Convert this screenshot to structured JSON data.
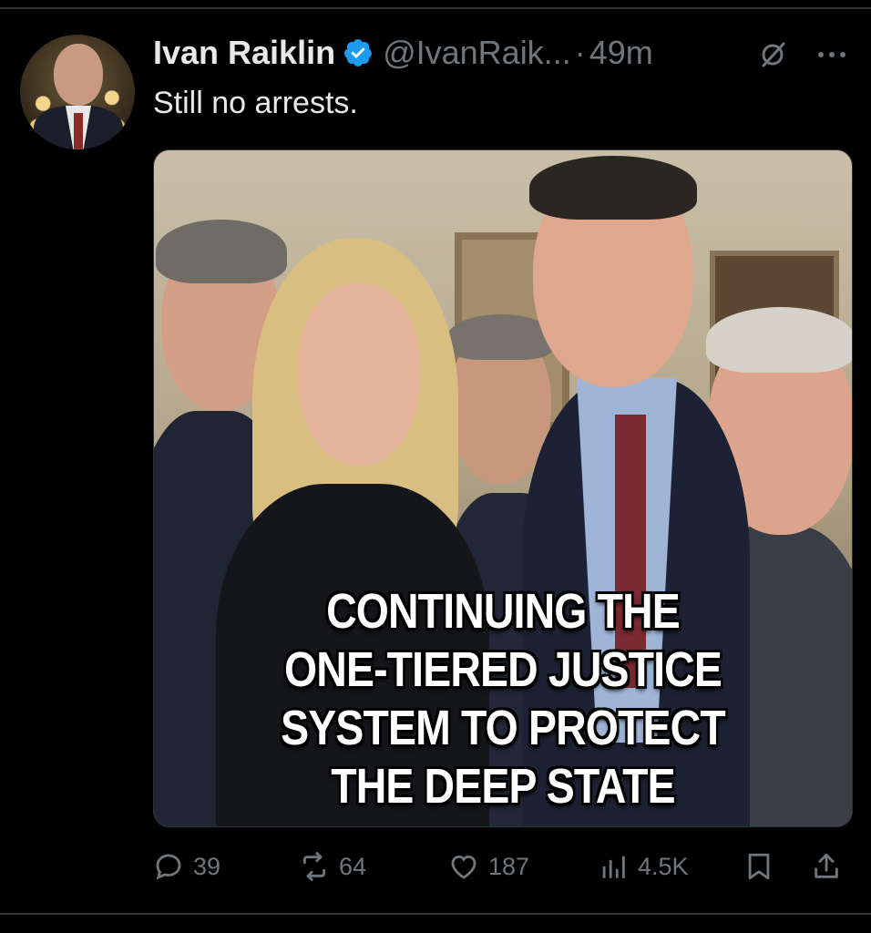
{
  "tweet": {
    "author_name": "Ivan Raiklin",
    "handle": "@IvanRaik...",
    "separator": "·",
    "time": "49m",
    "text": "Still no arrests.",
    "verified": true
  },
  "media": {
    "caption_lines": [
      "CONTINUING THE",
      "ONE-TIERED JUSTICE",
      "SYSTEM TO PROTECT",
      "THE DEEP STATE"
    ]
  },
  "actions": {
    "replies": "39",
    "reposts": "64",
    "likes": "187",
    "views": "4.5K"
  },
  "colors": {
    "background": "#000000",
    "text": "#e7e9ea",
    "muted": "#71767b",
    "verified": "#1d9bf0"
  },
  "icons": [
    "verified-badge-icon",
    "grok-icon",
    "more-icon",
    "reply-icon",
    "repost-icon",
    "like-icon",
    "views-icon",
    "bookmark-icon",
    "share-icon"
  ]
}
